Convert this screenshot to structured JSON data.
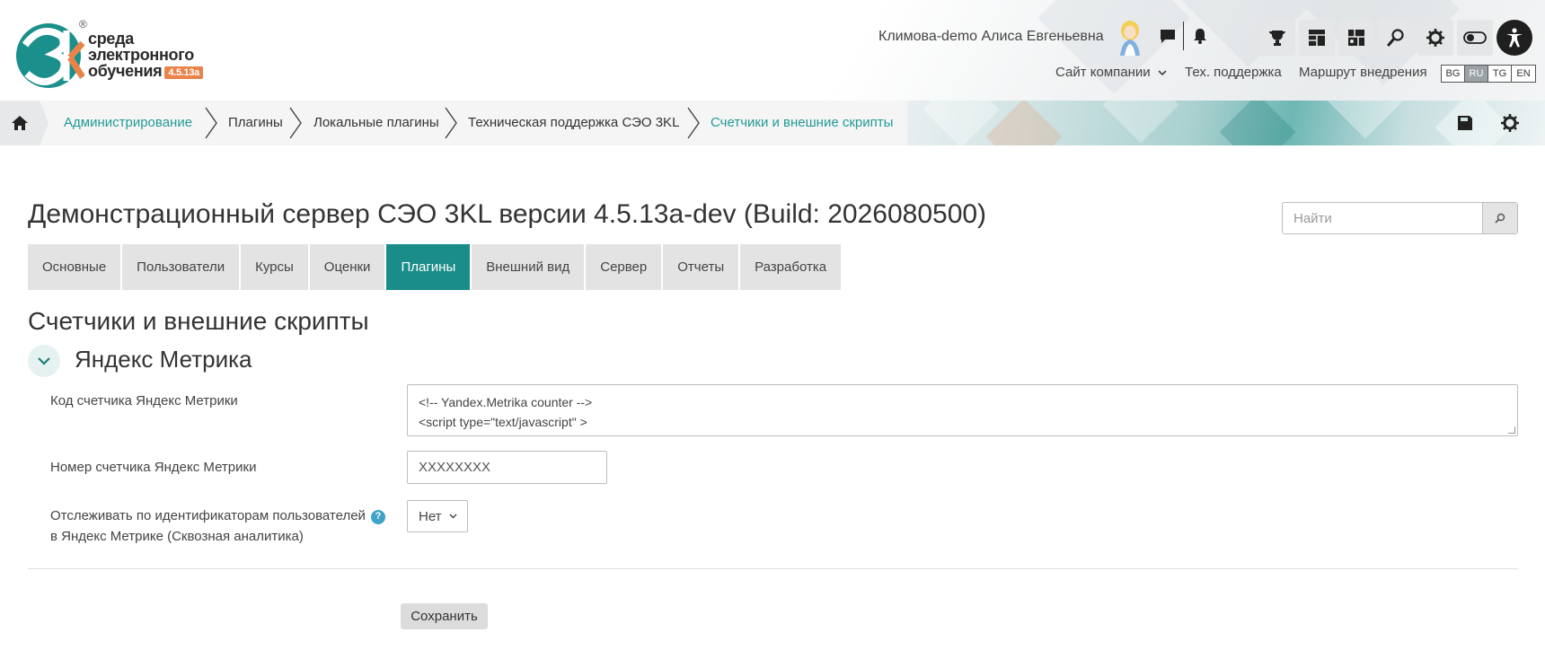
{
  "header": {
    "logo": {
      "line1": "среда",
      "line2": "электронного",
      "line3": "обучения",
      "version": "4.5.13a",
      "registered": "®"
    },
    "user_name": "Климова-demo Алиса Евгеньевна",
    "nav_links": [
      "Сайт компании",
      "Тех. поддержка",
      "Маршрут внедрения"
    ],
    "languages": [
      "BG",
      "RU",
      "TG",
      "EN"
    ],
    "active_language": "RU",
    "tool_icons": [
      "trophy-icon",
      "dashboard-icon",
      "courses-icon",
      "search-icon",
      "gear-icon",
      "theme-toggle-icon",
      "accessibility-icon"
    ]
  },
  "breadcrumb": {
    "items": [
      {
        "label": "Администрирование",
        "link": true
      },
      {
        "label": "Плагины",
        "link": false
      },
      {
        "label": "Локальные плагины",
        "link": false
      },
      {
        "label": "Техническая поддержка СЭО 3KL",
        "link": false
      },
      {
        "label": "Счетчики и внешние скрипты",
        "link": true
      }
    ]
  },
  "page": {
    "title": "Демонстрационный сервер СЭО 3KL версии 4.5.13a-dev (Build: 2026080500)",
    "search_placeholder": "Найти",
    "tabs": [
      "Основные",
      "Пользователи",
      "Курсы",
      "Оценки",
      "Плагины",
      "Внешний вид",
      "Сервер",
      "Отчеты",
      "Разработка"
    ],
    "active_tab": "Плагины",
    "section_title": "Счетчики и внешние скрипты",
    "fieldset_title": "Яндекс Метрика"
  },
  "form": {
    "code_label": "Код счетчика Яндекс Метрики",
    "code_lines": [
      "<!-- Yandex.Metrika counter -->",
      "<script type=\"text/javascript\" >"
    ],
    "number_label": "Номер счетчика Яндекс Метрики",
    "number_value": "XXXXXXXX",
    "track_label_line1": "Отслеживать по идентификаторам пользователей",
    "track_label_line2": "в Яндекс Метрике (Сквозная аналитика)",
    "help_glyph": "?",
    "track_value": "Нет",
    "save_label": "Сохранить"
  },
  "colors": {
    "accent": "#1a8d89",
    "link": "#239a96",
    "help": "#3ea3c7",
    "logo_badge": "#e9834a"
  }
}
